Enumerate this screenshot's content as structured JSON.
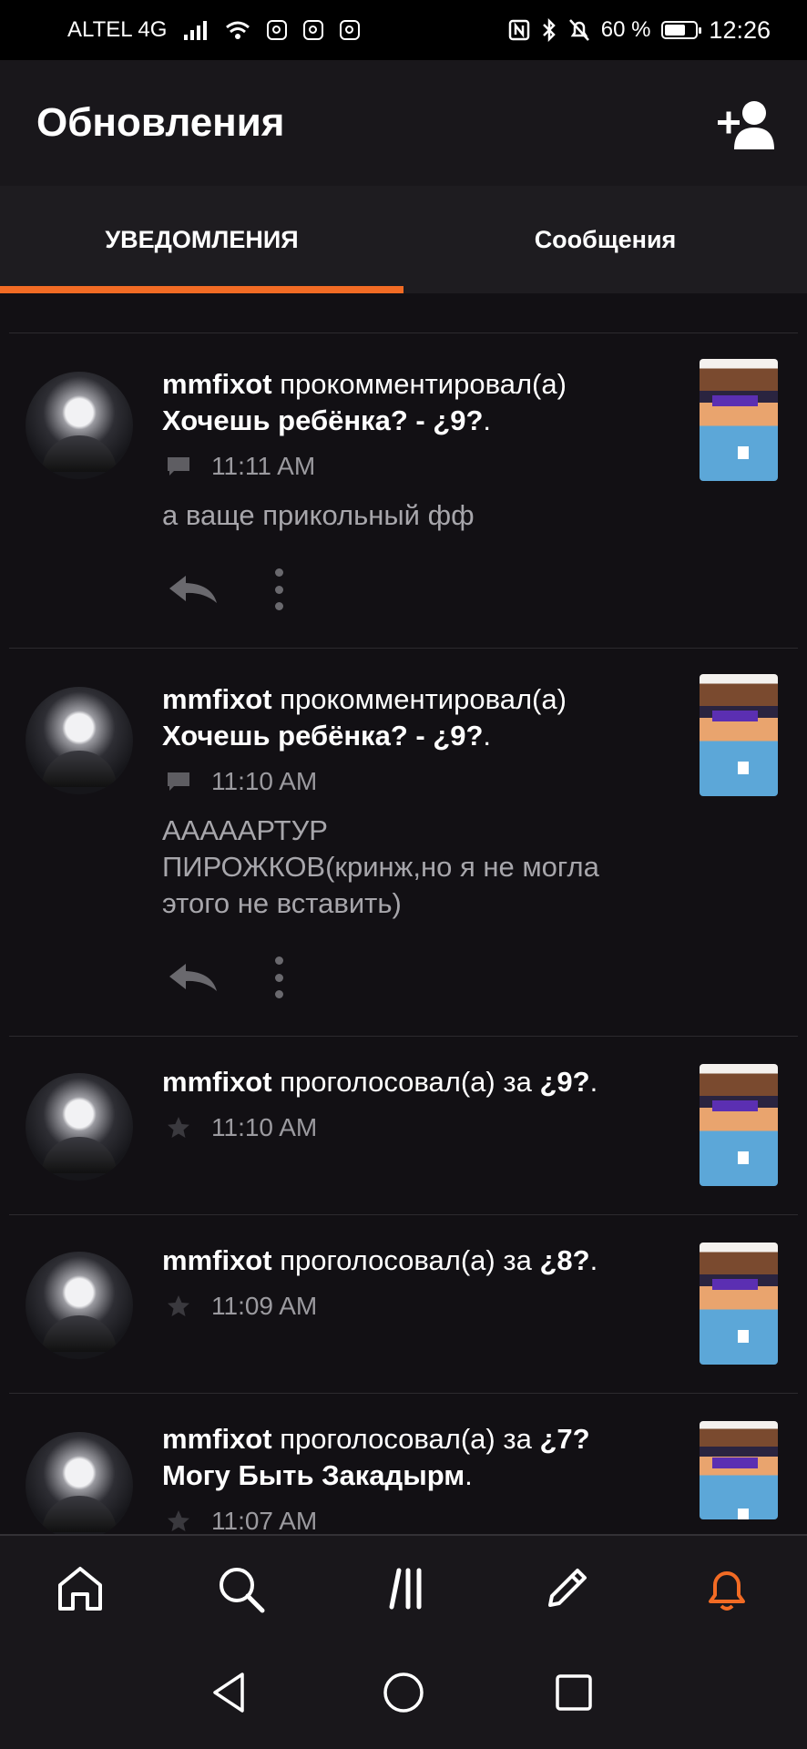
{
  "status_bar": {
    "carrier": "ALTEL 4G",
    "battery": "60 %",
    "time": "12:26",
    "icons": [
      "signal-icon",
      "wifi-icon",
      "instagram-icon",
      "instagram-icon",
      "instagram-icon",
      "nfc-icon",
      "bluetooth-icon",
      "bell-off-icon",
      "battery-icon"
    ]
  },
  "header": {
    "title": "Обновления",
    "action_icon": "add-user-icon"
  },
  "tabs": [
    {
      "label": "УВЕДОМЛЕНИЯ",
      "active": true
    },
    {
      "label": "Сообщения",
      "active": false
    }
  ],
  "colors": {
    "accent": "#f26b24",
    "background": "#121014",
    "header": "#19171b"
  },
  "notifications": [
    {
      "user": "mmfixot",
      "action": " прокомментировал(а)",
      "target": "Хочешь ребёнка? - ¿9?",
      "target_suffix": ".",
      "type_icon": "comment-icon",
      "time": "11:11 AM",
      "comment_lines": [
        "а ваще прикольный фф"
      ]
    },
    {
      "user": "mmfixot",
      "action": " прокомментировал(а)",
      "target": "Хочешь ребёнка? - ¿9?",
      "target_suffix": ".",
      "type_icon": "comment-icon",
      "time": "11:10 AM",
      "comment_lines": [
        "АААААРТУР",
        "ПИРОЖКОВ(кринж,но я не могла",
        "этого не вставить)"
      ]
    },
    {
      "user": "mmfixot",
      "action": " проголосовал(а) за ",
      "target": "¿9?",
      "target_suffix": ".",
      "type_icon": "star-icon",
      "time": "11:10 AM"
    },
    {
      "user": "mmfixot",
      "action": " проголосовал(а) за ",
      "target": "¿8?",
      "target_suffix": ".",
      "type_icon": "star-icon",
      "time": "11:09 AM"
    },
    {
      "user": "mmfixot",
      "action": " проголосовал(а) за ",
      "target": "¿7?",
      "target2": "Могу Быть Закадырм",
      "target_suffix": ".",
      "type_icon": "star-icon",
      "time": "11:07 AM"
    }
  ],
  "bottom_nav": [
    {
      "icon": "home-icon",
      "active": false
    },
    {
      "icon": "search-icon",
      "active": false
    },
    {
      "icon": "library-icon",
      "active": false
    },
    {
      "icon": "pencil-icon",
      "active": false
    },
    {
      "icon": "bell-icon",
      "active": true
    }
  ],
  "system_nav": [
    "back-icon",
    "home-circle-icon",
    "recents-icon"
  ]
}
